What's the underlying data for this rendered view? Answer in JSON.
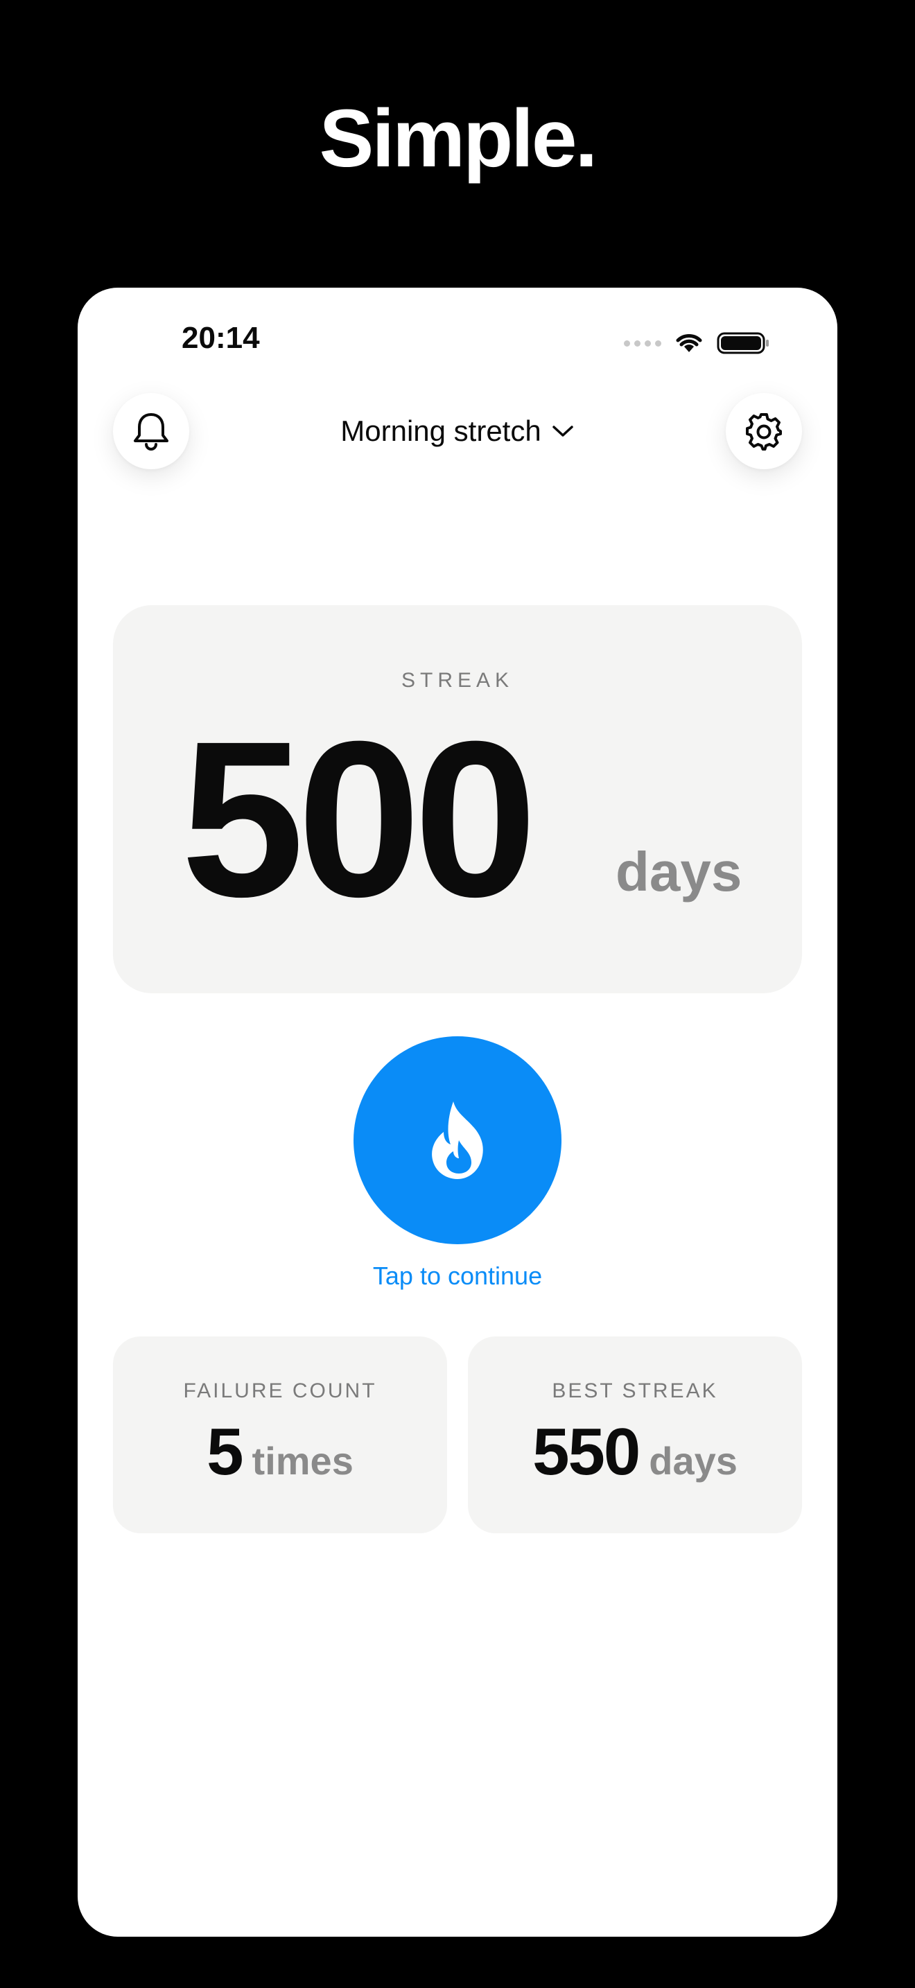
{
  "headline": "Simple.",
  "status_bar": {
    "time": "20:14"
  },
  "header": {
    "habit_title": "Morning stretch",
    "bell_icon": "bell-icon",
    "settings_icon": "gear-icon",
    "dropdown_icon": "chevron-down-icon"
  },
  "streak": {
    "label": "STREAK",
    "value": "500",
    "unit": "days"
  },
  "action": {
    "icon": "flame-icon",
    "label": "Tap to continue"
  },
  "stats": {
    "failure": {
      "label": "FAILURE COUNT",
      "value": "5",
      "unit": "times"
    },
    "best": {
      "label": "BEST STREAK",
      "value": "550",
      "unit": "days"
    }
  },
  "colors": {
    "accent": "#0a8cf7",
    "background": "#000000",
    "card": "#f4f4f3",
    "muted_text": "#8a8a8a"
  }
}
